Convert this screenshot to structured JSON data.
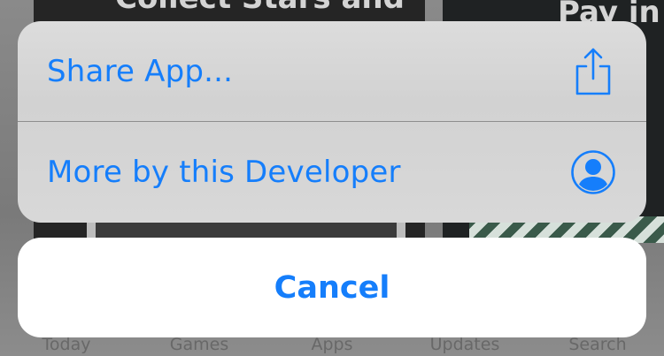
{
  "background": {
    "card_left_text": "Collect Stars and",
    "card_right_text": "Pay in st",
    "tabs": [
      {
        "label": "Today"
      },
      {
        "label": "Games"
      },
      {
        "label": "Apps"
      },
      {
        "label": "Updates"
      },
      {
        "label": "Search"
      }
    ]
  },
  "action_sheet": {
    "actions": [
      {
        "label": "Share App...",
        "icon": "share-icon"
      },
      {
        "label": "More by this Developer",
        "icon": "developer-profile-icon"
      }
    ],
    "cancel_label": "Cancel"
  },
  "colors": {
    "accent": "#157efb",
    "sheet_background": "#d6d6d6",
    "cancel_background": "#ffffff"
  }
}
